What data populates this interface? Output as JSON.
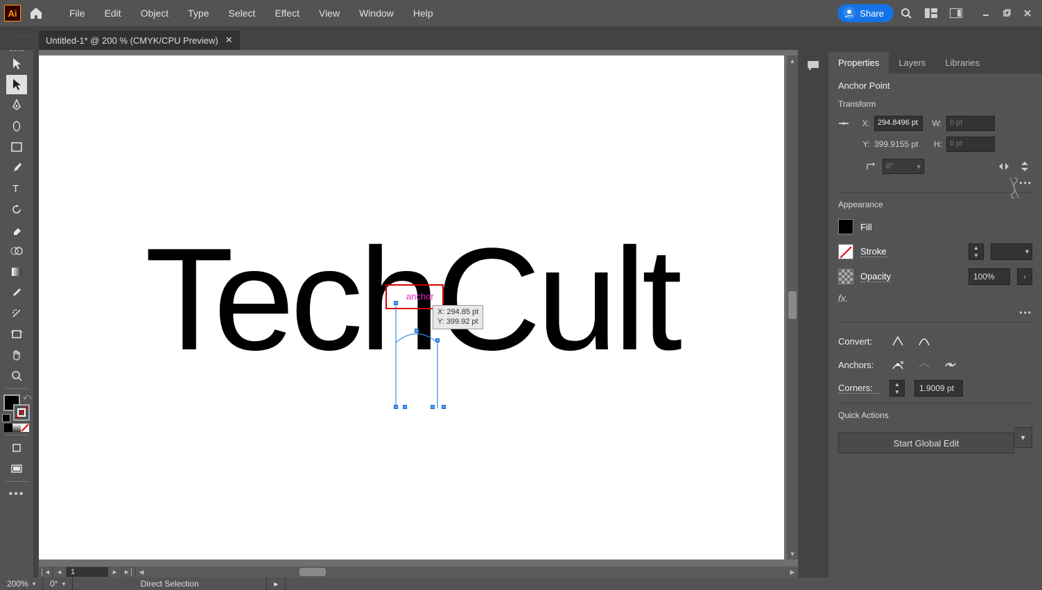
{
  "menubar": {
    "items": [
      "File",
      "Edit",
      "Object",
      "Type",
      "Select",
      "Effect",
      "View",
      "Window",
      "Help"
    ],
    "share": "Share"
  },
  "tab": {
    "title": "Untitled-1* @ 200 % (CMYK/CPU Preview)"
  },
  "canvas": {
    "text": "TechCult",
    "anchor_label": "anchor",
    "tooltip_x": "X: 294.85 pt",
    "tooltip_y": "Y: 399.92 pt"
  },
  "statusbar": {
    "zoom": "200%",
    "rotation": "0°",
    "tool": "Direct Selection",
    "artboard": "1"
  },
  "props": {
    "tabs": [
      "Properties",
      "Layers",
      "Libraries"
    ],
    "heading": "Anchor Point",
    "transform": {
      "title": "Transform",
      "x": "294.8496 pt",
      "y": "399.9155 pt",
      "w": "0 pt",
      "h": "0 pt",
      "angle": "0°"
    },
    "appearance": {
      "title": "Appearance",
      "fill": "Fill",
      "stroke": "Stroke",
      "opacity": "Opacity",
      "opacity_val": "100%"
    },
    "convert": "Convert:",
    "anchors": "Anchors:",
    "corners": {
      "label": "Corners:",
      "value": "1.9009 pt"
    },
    "quick": {
      "title": "Quick Actions",
      "global_edit": "Start Global Edit"
    }
  }
}
